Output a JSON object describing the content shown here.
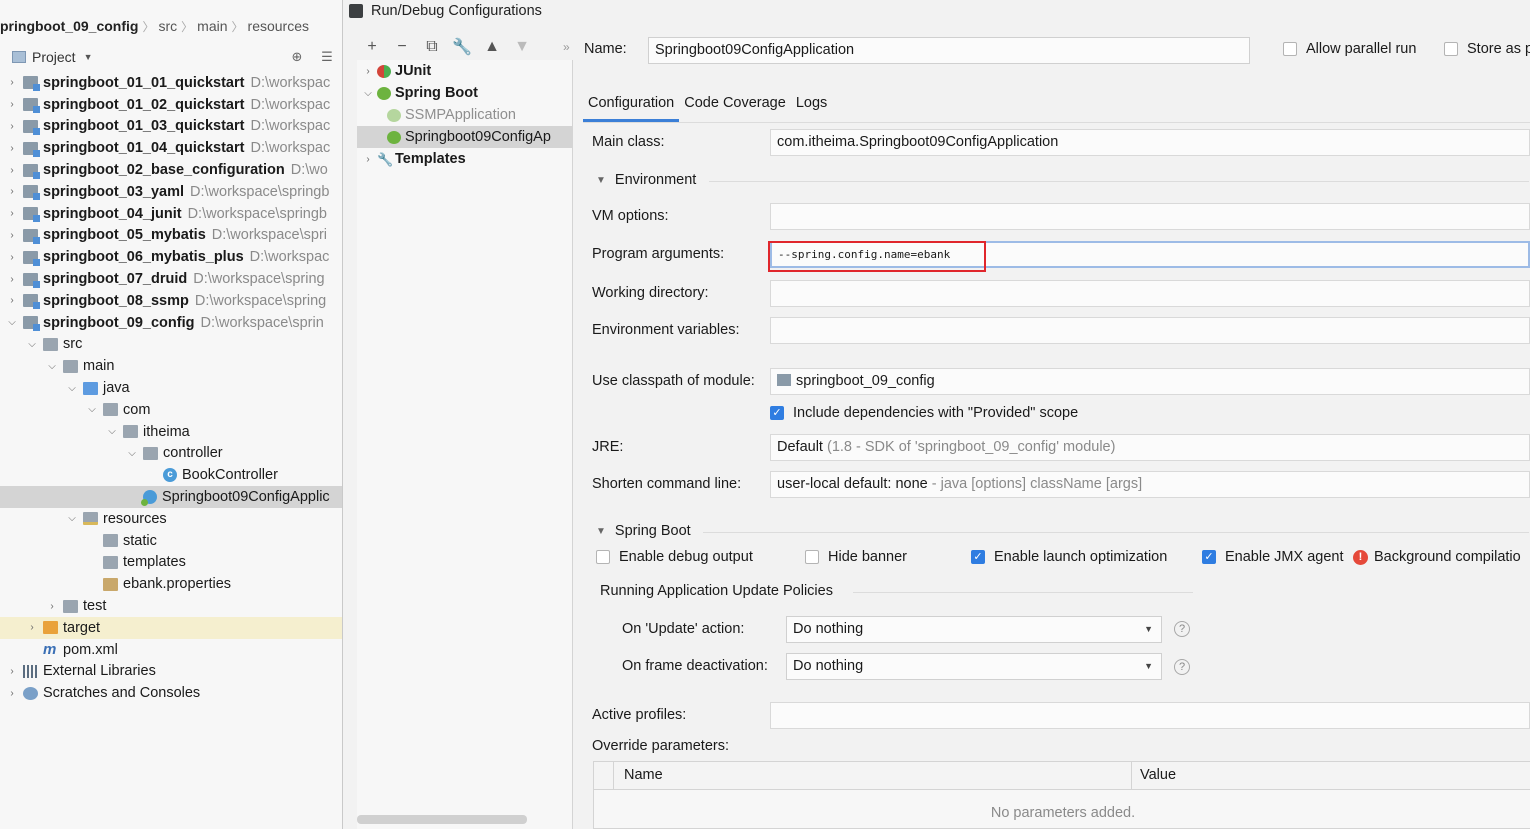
{
  "breadcrumb": [
    "pringboot_09_config",
    "src",
    "main",
    "resources"
  ],
  "project_panel": {
    "title": "Project",
    "tree": [
      {
        "name": "springboot_01_01_quickstart",
        "path": "D:\\workspac",
        "type": "module",
        "level": 0,
        "arrow": ">",
        "bold": true
      },
      {
        "name": "springboot_01_02_quickstart",
        "path": "D:\\workspac",
        "type": "module",
        "level": 0,
        "arrow": ">",
        "bold": true
      },
      {
        "name": "springboot_01_03_quickstart",
        "path": "D:\\workspac",
        "type": "module",
        "level": 0,
        "arrow": ">",
        "bold": true
      },
      {
        "name": "springboot_01_04_quickstart",
        "path": "D:\\workspac",
        "type": "module",
        "level": 0,
        "arrow": ">",
        "bold": true
      },
      {
        "name": "springboot_02_base_configuration",
        "path": "D:\\wo",
        "type": "module",
        "level": 0,
        "arrow": ">",
        "bold": true
      },
      {
        "name": "springboot_03_yaml",
        "path": "D:\\workspace\\springb",
        "type": "module",
        "level": 0,
        "arrow": ">",
        "bold": true
      },
      {
        "name": "springboot_04_junit",
        "path": "D:\\workspace\\springb",
        "type": "module",
        "level": 0,
        "arrow": ">",
        "bold": true
      },
      {
        "name": "springboot_05_mybatis",
        "path": "D:\\workspace\\spri",
        "type": "module",
        "level": 0,
        "arrow": ">",
        "bold": true
      },
      {
        "name": "springboot_06_mybatis_plus",
        "path": "D:\\workspac",
        "type": "module",
        "level": 0,
        "arrow": ">",
        "bold": true
      },
      {
        "name": "springboot_07_druid",
        "path": "D:\\workspace\\spring",
        "type": "module",
        "level": 0,
        "arrow": ">",
        "bold": true
      },
      {
        "name": "springboot_08_ssmp",
        "path": "D:\\workspace\\spring",
        "type": "module",
        "level": 0,
        "arrow": ">",
        "bold": true
      },
      {
        "name": "springboot_09_config",
        "path": "D:\\workspace\\sprin",
        "type": "module",
        "level": 0,
        "arrow": "v",
        "bold": true
      },
      {
        "name": "src",
        "path": "",
        "type": "folder",
        "level": 1,
        "arrow": "v",
        "bold": false
      },
      {
        "name": "main",
        "path": "",
        "type": "folder",
        "level": 2,
        "arrow": "v",
        "bold": false
      },
      {
        "name": "java",
        "path": "",
        "type": "folder-blue",
        "level": 3,
        "arrow": "v",
        "bold": false
      },
      {
        "name": "com",
        "path": "",
        "type": "folder",
        "level": 4,
        "arrow": "v",
        "bold": false
      },
      {
        "name": "itheima",
        "path": "",
        "type": "folder",
        "level": 5,
        "arrow": "v",
        "bold": false
      },
      {
        "name": "controller",
        "path": "",
        "type": "folder",
        "level": 6,
        "arrow": "v",
        "bold": false
      },
      {
        "name": "BookController",
        "path": "",
        "type": "class-c",
        "level": 7,
        "arrow": "",
        "bold": false
      },
      {
        "name": "Springboot09ConfigApplic",
        "path": "",
        "type": "spring-c",
        "level": 6,
        "arrow": "",
        "bold": false,
        "selected": true
      },
      {
        "name": "resources",
        "path": "",
        "type": "folder-res",
        "level": 3,
        "arrow": "v",
        "bold": false
      },
      {
        "name": "static",
        "path": "",
        "type": "folder",
        "level": 4,
        "arrow": "",
        "bold": false
      },
      {
        "name": "templates",
        "path": "",
        "type": "folder",
        "level": 4,
        "arrow": "",
        "bold": false
      },
      {
        "name": "ebank.properties",
        "path": "",
        "type": "props",
        "level": 4,
        "arrow": "",
        "bold": false
      },
      {
        "name": "test",
        "path": "",
        "type": "folder",
        "level": 2,
        "arrow": ">",
        "bold": false
      },
      {
        "name": "target",
        "path": "",
        "type": "folder-orange",
        "level": 1,
        "arrow": ">",
        "bold": false,
        "highlight": true
      },
      {
        "name": "pom.xml",
        "path": "",
        "type": "maven",
        "level": 1,
        "arrow": "",
        "bold": false
      },
      {
        "name": "External Libraries",
        "path": "",
        "type": "libs",
        "level": 0,
        "arrow": ">",
        "bold": false
      },
      {
        "name": "Scratches and Consoles",
        "path": "",
        "type": "scratch",
        "level": 0,
        "arrow": ">",
        "bold": false
      }
    ]
  },
  "dialog": {
    "title": "Run/Debug Configurations",
    "toolbar": [
      "+",
      "−",
      "⧉",
      "🔧",
      "▲",
      "▼"
    ],
    "config_tree": [
      {
        "label": "JUnit",
        "icon": "junit",
        "arrow": ">",
        "bold": true,
        "indent": 0
      },
      {
        "label": "Spring Boot",
        "icon": "spring",
        "arrow": "v",
        "bold": true,
        "indent": 0
      },
      {
        "label": "SSMPApplication",
        "icon": "spring-dim",
        "arrow": "",
        "bold": false,
        "dim": true,
        "indent": 1
      },
      {
        "label": "Springboot09ConfigAp",
        "icon": "spring",
        "arrow": "",
        "bold": false,
        "indent": 1,
        "selected": true
      },
      {
        "label": "Templates",
        "icon": "wrench",
        "arrow": ">",
        "bold": true,
        "indent": 0
      }
    ],
    "name_label": "Name:",
    "name_value": "Springboot09ConfigApplication",
    "allow_parallel": "Allow parallel run",
    "store_as": "Store as p",
    "tabs": [
      "Configuration",
      "Code Coverage",
      "Logs"
    ],
    "main_class_label": "Main class:",
    "main_class_value": "com.itheima.Springboot09ConfigApplication",
    "environment_section": "Environment",
    "vm_options_label": "VM options:",
    "program_args_label": "Program arguments:",
    "program_args_value": "--spring.config.name=ebank",
    "working_dir_label": "Working directory:",
    "env_vars_label": "Environment variables:",
    "classpath_label": "Use classpath of module:",
    "classpath_value": "springboot_09_config",
    "include_deps": "Include dependencies with \"Provided\" scope",
    "jre_label": "JRE:",
    "jre_value": "Default",
    "jre_detail": "(1.8 - SDK of 'springboot_09_config' module)",
    "shorten_label": "Shorten command line:",
    "shorten_value": "user-local default: none",
    "shorten_detail": "- java [options] className [args]",
    "springboot_section": "Spring Boot",
    "debug_output": "Enable debug output",
    "hide_banner": "Hide banner",
    "launch_opt": "Enable launch optimization",
    "jmx_agent": "Enable JMX agent",
    "background_comp": "Background compilatio",
    "update_policies": "Running Application Update Policies",
    "on_update_label": "On 'Update' action:",
    "on_update_value": "Do nothing",
    "on_frame_label": "On frame deactivation:",
    "on_frame_value": "Do nothing",
    "active_profiles_label": "Active profiles:",
    "override_label": "Override parameters:",
    "col_name": "Name",
    "col_value": "Value",
    "no_params": "No parameters added."
  }
}
